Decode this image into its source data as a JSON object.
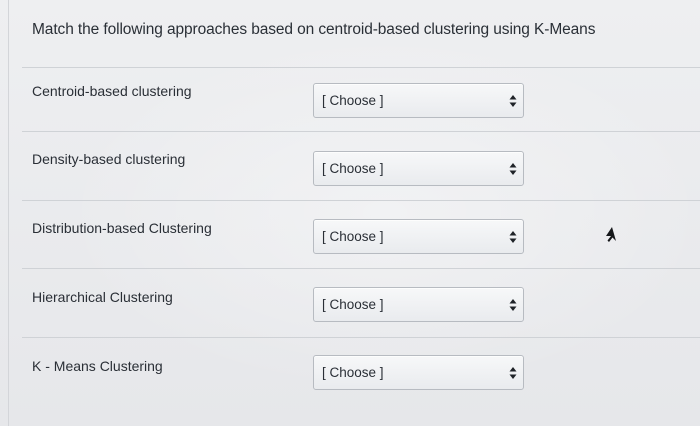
{
  "question": {
    "text": "Match the following approaches based on centroid-based clustering using K-Means"
  },
  "rows": [
    {
      "label": "Centroid-based clustering",
      "select_value": "[ Choose ]"
    },
    {
      "label": "Density-based clustering",
      "select_value": "[ Choose ]"
    },
    {
      "label": "Distribution-based Clustering",
      "select_value": "[ Choose ]"
    },
    {
      "label": "Hierarchical Clustering",
      "select_value": "[ Choose ]"
    },
    {
      "label": "K - Means Clustering",
      "select_value": "[ Choose ]"
    }
  ],
  "icons": {
    "select_arrows": "up-down-arrows-icon",
    "cursor": "mouse-pointer-icon"
  }
}
